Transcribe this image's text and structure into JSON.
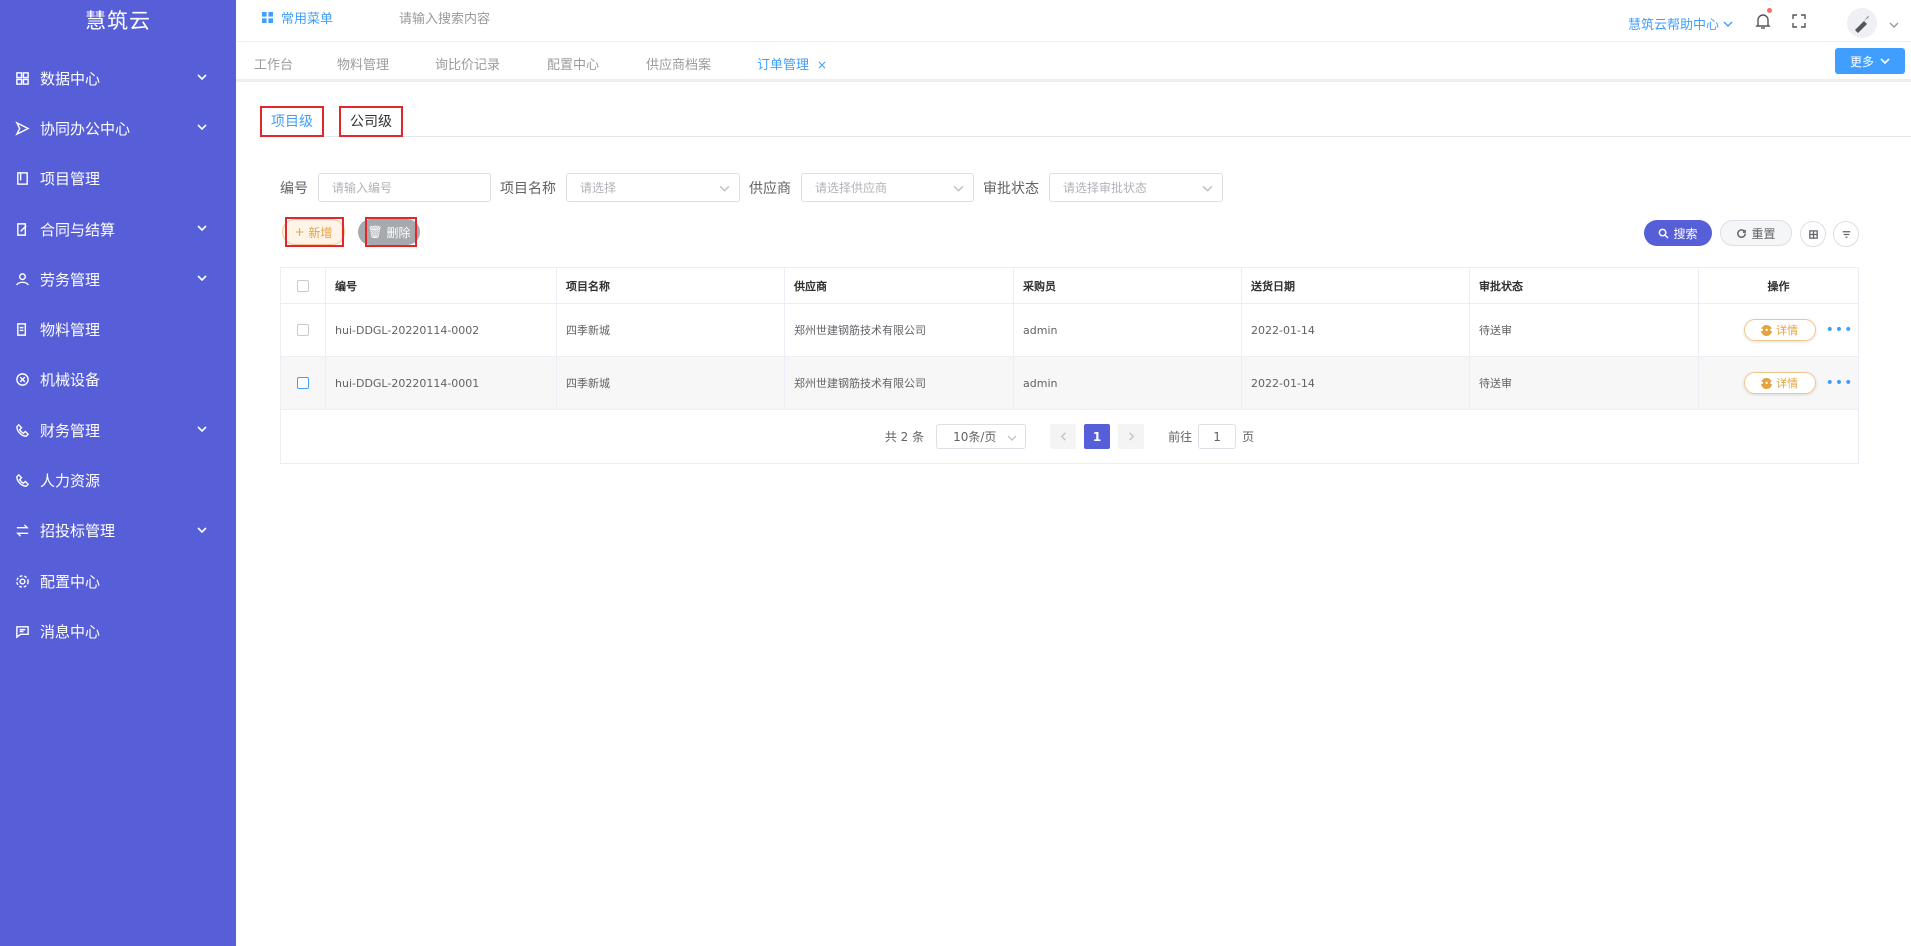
{
  "brand": "慧筑云",
  "sidebar": {
    "items": [
      {
        "label": "数据中心",
        "icon": "grid-icon",
        "expandable": true
      },
      {
        "label": "协同办公中心",
        "icon": "send-icon",
        "expandable": true
      },
      {
        "label": "项目管理",
        "icon": "book-icon",
        "expandable": false
      },
      {
        "label": "合同与结算",
        "icon": "edit-doc-icon",
        "expandable": true
      },
      {
        "label": "劳务管理",
        "icon": "worker-icon",
        "expandable": true
      },
      {
        "label": "物料管理",
        "icon": "material-icon",
        "expandable": false
      },
      {
        "label": "机械设备",
        "icon": "cross-circle-icon",
        "expandable": false
      },
      {
        "label": "财务管理",
        "icon": "phone-icon",
        "expandable": true
      },
      {
        "label": "人力资源",
        "icon": "phone-icon",
        "expandable": false
      },
      {
        "label": "招投标管理",
        "icon": "transfer-icon",
        "expandable": true
      },
      {
        "label": "配置中心",
        "icon": "gear-icon",
        "expandable": false
      },
      {
        "label": "消息中心",
        "icon": "message-icon",
        "expandable": false
      }
    ]
  },
  "header": {
    "menu_label": "常用菜单",
    "search_placeholder": "请输入搜索内容",
    "help_label": "慧筑云帮助中心"
  },
  "tags": {
    "items": [
      "工作台",
      "物料管理",
      "询比价记录",
      "配置中心",
      "供应商档案",
      "订单管理"
    ],
    "active": "订单管理",
    "close_glyph": "×",
    "more_label": "更多"
  },
  "level_tabs": [
    "项目级",
    "公司级"
  ],
  "filters": {
    "number_label": "编号",
    "number_placeholder": "请输入编号",
    "project_label": "项目名称",
    "project_placeholder": "请选择",
    "supplier_label": "供应商",
    "supplier_placeholder": "请选择供应商",
    "status_label": "审批状态",
    "status_placeholder": "请选择审批状态"
  },
  "toolbar": {
    "add_label": "新增",
    "delete_label": "删除",
    "search_label": "搜索",
    "reset_label": "重置"
  },
  "table": {
    "columns": [
      "编号",
      "项目名称",
      "供应商",
      "采购员",
      "送货日期",
      "审批状态",
      "操作"
    ],
    "rows": [
      {
        "number": "hui-DDGL-20220114-0002",
        "project": "四季新城",
        "supplier": "郑州世建钢筋技术有限公司",
        "buyer": "admin",
        "date": "2022-01-14",
        "status": "待送审",
        "action": "详情"
      },
      {
        "number": "hui-DDGL-20220114-0001",
        "project": "四季新城",
        "supplier": "郑州世建钢筋技术有限公司",
        "buyer": "admin",
        "date": "2022-01-14",
        "status": "待送审",
        "action": "详情"
      }
    ]
  },
  "pager": {
    "total": "共 2 条",
    "page_size": "10条/页",
    "current": "1",
    "goto_prefix": "前往",
    "goto_value": "1",
    "goto_suffix": "页"
  },
  "colors": {
    "sidebar_bg": "#575fd8",
    "primary": "#409eff",
    "warning": "#e6a23c",
    "highlight_box": "#e3262b"
  }
}
